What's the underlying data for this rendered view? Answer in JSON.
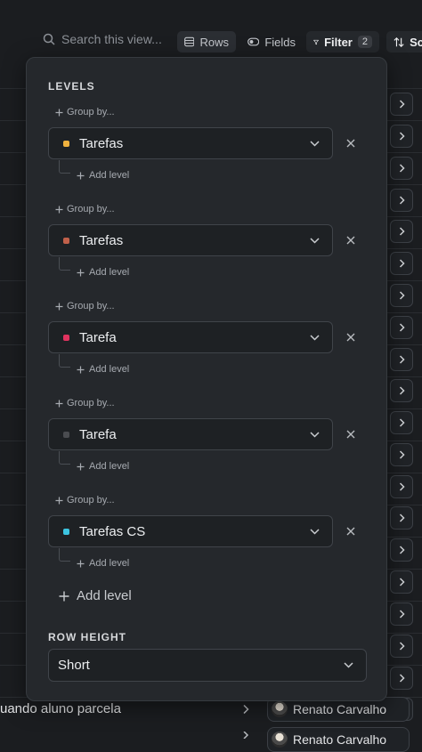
{
  "toolbar": {
    "search_placeholder": "Search this view...",
    "rows_label": "Rows",
    "fields_label": "Fields",
    "filter_label": "Filter",
    "filter_count": "2",
    "sort_label": "Sc"
  },
  "panel": {
    "levels_title": "LEVELS",
    "group_by_label": "Group by...",
    "add_level_label": "Add level",
    "levels": [
      {
        "label": "Tarefas",
        "color": "#f0b23e"
      },
      {
        "label": "Tarefas",
        "color": "#c0604a"
      },
      {
        "label": "Tarefa",
        "color": "#e0335f"
      },
      {
        "label": "Tarefa",
        "color": "#4a4c50"
      },
      {
        "label": "Tarefas CS",
        "color": "#3cc4e0"
      }
    ],
    "add_level_main": "Add level",
    "row_height_title": "ROW HEIGHT",
    "row_height_value": "Short"
  },
  "background": {
    "row_text": "uando aluno parcela",
    "person_name": "Renato Carvalho",
    "person_name_partial": "Renato Carvalho"
  }
}
